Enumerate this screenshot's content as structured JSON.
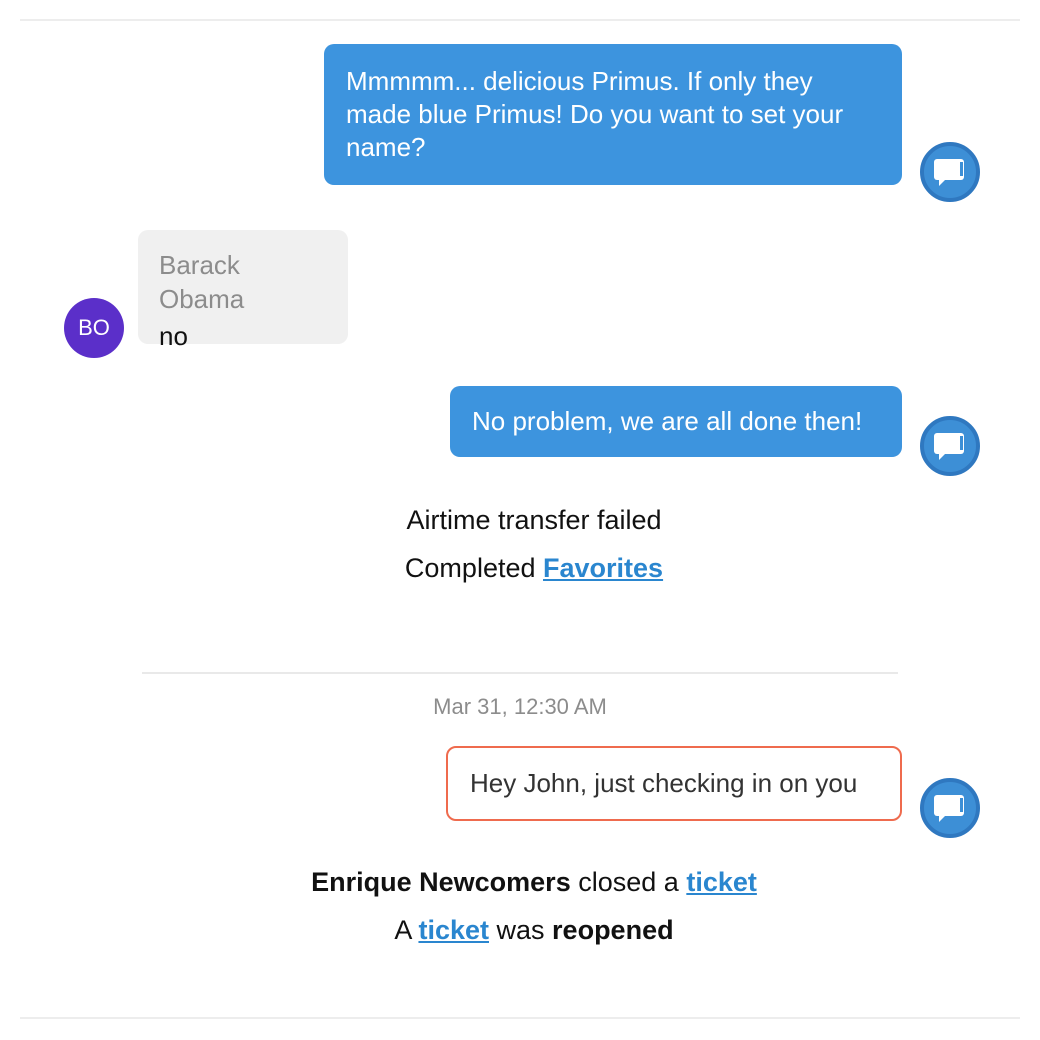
{
  "messages": {
    "m1": {
      "text": "Mmmmm... delicious Primus. If only they made blue Primus! Do you want to set your name?"
    },
    "m2": {
      "sender": "Barack Obama",
      "text": "no",
      "avatar_initials": "BO"
    },
    "m3": {
      "text": "No problem, we are all done then!"
    },
    "m4": {
      "text": "Hey John, just checking in on you"
    }
  },
  "events": {
    "airtime": "Airtime transfer failed",
    "completed_prefix": "Completed",
    "completed_link": "Favorites",
    "closed_actor": "Enrique Newcomers",
    "closed_mid": "closed a",
    "closed_link": "ticket",
    "reopen_a": "A",
    "reopen_link": "ticket",
    "reopen_was": "was",
    "reopen_bold": "reopened"
  },
  "timestamp": "Mar 31, 12:30 AM",
  "icons": {
    "bot_avatar": "chat-bubble-icon"
  },
  "colors": {
    "outgoing_bubble": "#3d94de",
    "incoming_bubble": "#f0f0f0",
    "avatar_purple": "#5b2fc9",
    "link": "#2a86cf",
    "highlight_border": "#ef6b4e"
  }
}
